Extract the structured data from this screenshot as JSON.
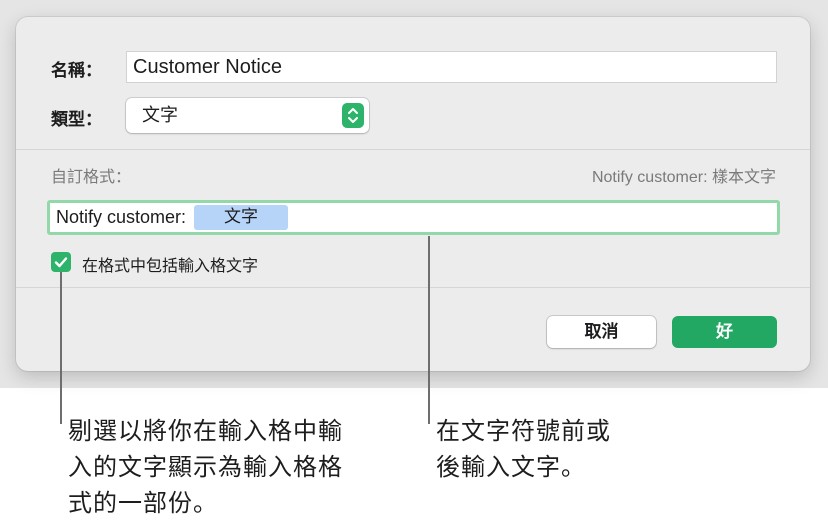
{
  "dialog": {
    "name_label": "名稱：",
    "name_value": "Customer Notice",
    "type_label": "類型：",
    "type_value": "文字",
    "custom_format_label": "自訂格式：",
    "sample_text": "Notify customer: 樣本文字",
    "format_prefix": "Notify customer:",
    "format_token": "文字",
    "checkbox_label": "在格式中包括輸入格文字",
    "checkbox_checked": true,
    "cancel_label": "取消",
    "ok_label": "好"
  },
  "callouts": {
    "left": [
      "剔選以將你在輸入格中輸",
      "入的文字顯示為輸入格格",
      "式的一部份。"
    ],
    "right": [
      "在文字符號前或",
      "後輸入文字。"
    ]
  },
  "colors": {
    "accent": "#22a862",
    "focus_ring": "#92d8a8",
    "token_bg": "#b6d4f7"
  },
  "icons": {
    "stepper": "chevron-up-down-icon",
    "checkbox": "checkmark-icon"
  }
}
